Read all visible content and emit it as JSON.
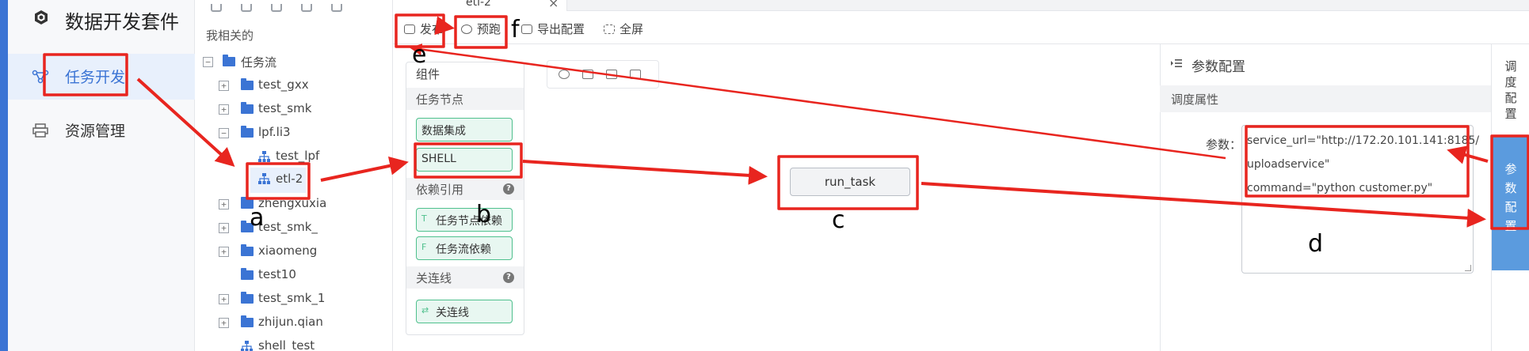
{
  "app": {
    "title": "数据开发套件",
    "nav": [
      {
        "label": "任务开发",
        "icon": "network-icon",
        "active": true
      },
      {
        "label": "资源管理",
        "icon": "printer-icon",
        "active": false
      }
    ]
  },
  "tree": {
    "section_title": "我相关的",
    "root_label": "任务流",
    "items": [
      {
        "label": "test_gxx",
        "expander": "+"
      },
      {
        "label": "test_smk",
        "expander": "+"
      },
      {
        "label": "lpf.li3",
        "expander": "−"
      },
      {
        "label": "test_lpf",
        "expander": ""
      },
      {
        "label": "etl-2",
        "expander": ""
      },
      {
        "label": "zhengxuxia",
        "expander": "+"
      },
      {
        "label": "test_smk_",
        "expander": "+"
      },
      {
        "label": "xiaomeng",
        "expander": "+"
      },
      {
        "label": "test10",
        "expander": ""
      },
      {
        "label": "test_smk_1",
        "expander": "+"
      },
      {
        "label": "zhijun.qian",
        "expander": "+"
      },
      {
        "label": "shell_test",
        "expander": ""
      }
    ]
  },
  "tab": {
    "label": "etl-2",
    "close": "×"
  },
  "toolbar": {
    "publish": "发布",
    "preview": "预跑",
    "export": "导出配置",
    "fullscreen": "全屏"
  },
  "palette": {
    "title": "组件",
    "task_nodes_title": "任务节点",
    "task_nodes": [
      "数据集成",
      "SHELL"
    ],
    "dependency_title": "依赖引用",
    "dependency_items": [
      {
        "tag": "T",
        "label": "任务节点依赖"
      },
      {
        "tag": "F",
        "label": "任务流依赖"
      }
    ],
    "link_title": "关连线",
    "link_item": "关连线",
    "help": "?"
  },
  "canvas": {
    "node_label": "run_task"
  },
  "param_panel": {
    "title": "参数配置",
    "section": "调度属性",
    "param_label": "参数：",
    "param_lines": [
      "service_url=\"http://172.20.101.141:8185/",
      "uploadservice\"",
      "command=\"python customer.py\""
    ]
  },
  "vtabs": {
    "schedule": [
      "调",
      "度",
      "配",
      "置"
    ],
    "params": [
      "参",
      "数",
      "配",
      "置"
    ]
  },
  "annotations": {
    "labels": {
      "a": "a",
      "b": "b",
      "c": "c",
      "d": "d",
      "e": "e",
      "f": "f"
    },
    "color": "#e8251f"
  },
  "colors": {
    "accent": "#3b74d4",
    "component_green": "#4fc08d",
    "active_tab": "#5b9bde"
  }
}
